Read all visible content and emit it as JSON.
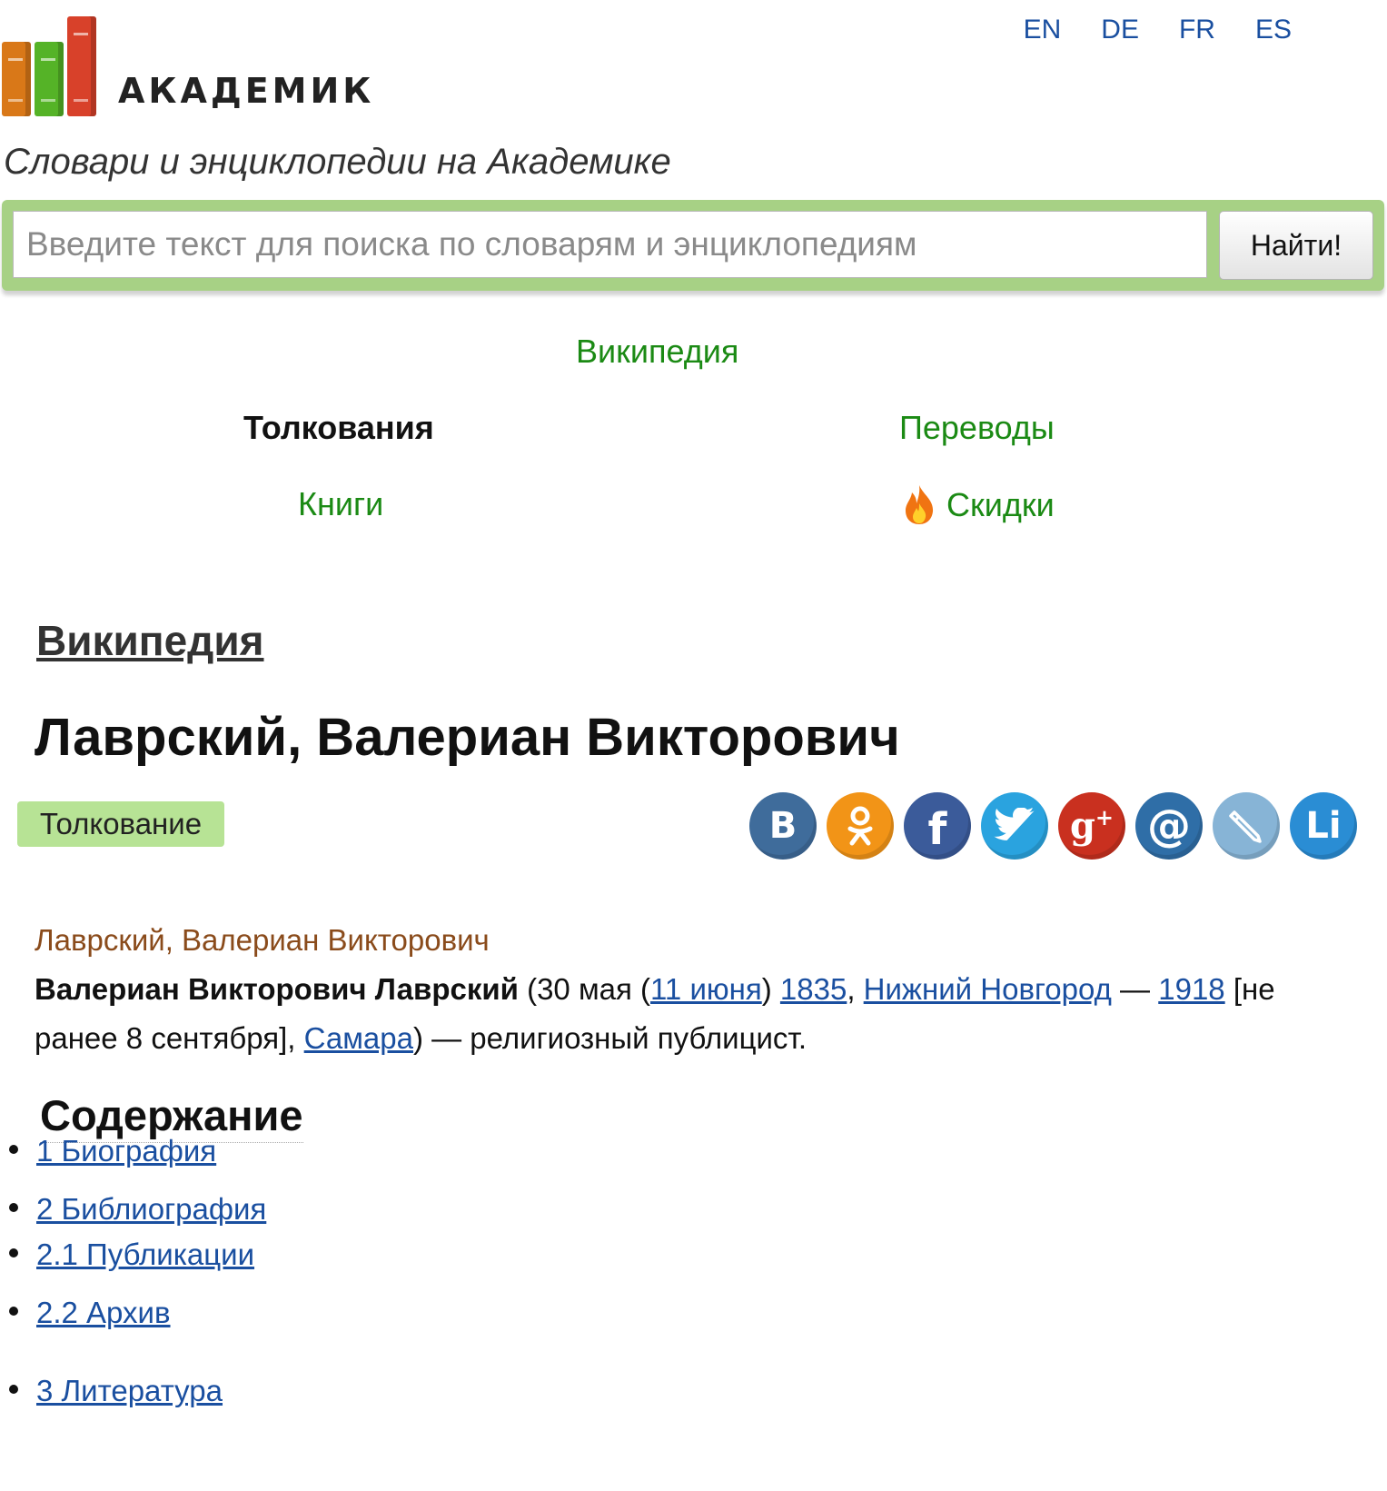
{
  "logo": {
    "text": "АКАДЕМИК"
  },
  "languages": [
    "EN",
    "DE",
    "FR",
    "ES"
  ],
  "tagline": "Словари и энциклопедии на Академике",
  "search": {
    "placeholder": "Введите текст для поиска по словарям и энциклопедиям",
    "button": "Найти!"
  },
  "nav": {
    "wikipedia": "Википедия",
    "interpretations": "Толкования",
    "translations": "Переводы",
    "books": "Книги",
    "discounts": "Скидки"
  },
  "article": {
    "source": "Википедия",
    "title": "Лаврский, Валериан Викторович",
    "badge": "Толкование",
    "entry_head": "Лаврский, Валериан Викторович",
    "entry": {
      "name_bold": "Валериан Викторович Лаврский",
      "t1": " (30 мая (",
      "link1": "11 июня",
      "t2": ") ",
      "link2": "1835",
      "t3": ", ",
      "link3": "Нижний Новгород",
      "t4": " — ",
      "link4": "1918",
      "t5": " [не ранее 8 сентября], ",
      "link5": "Самара",
      "t6": ") — религиозный публицист."
    }
  },
  "share": [
    {
      "name": "vk",
      "label": "B",
      "color": "#3f6c9b"
    },
    {
      "name": "odnoklassniki",
      "label": "ok",
      "color": "#f29417"
    },
    {
      "name": "facebook",
      "label": "f",
      "color": "#3b5b9a"
    },
    {
      "name": "twitter",
      "label": "tw",
      "color": "#2aa3df"
    },
    {
      "name": "google-plus",
      "label": "g+",
      "color": "#c9301f"
    },
    {
      "name": "mail",
      "label": "@",
      "color": "#2f6ea7"
    },
    {
      "name": "livejournal",
      "label": "pencil",
      "color": "#87b4d6"
    },
    {
      "name": "liveinternet",
      "label": "Li",
      "color": "#2a8dd4"
    }
  ],
  "toc": {
    "title": "Содержание",
    "items": [
      "1 Биография",
      "2 Библиография",
      "2.1 Публикации",
      "2.2 Архив",
      "3 Литература"
    ]
  }
}
